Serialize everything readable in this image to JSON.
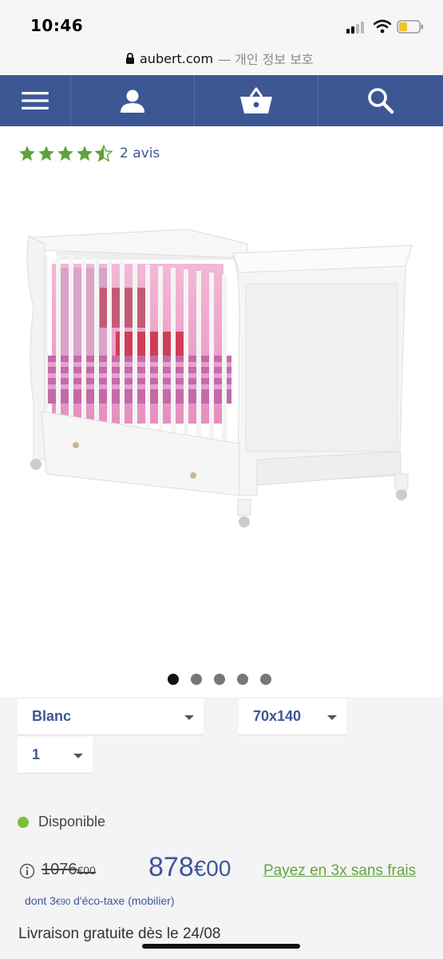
{
  "status_bar": {
    "time": "10:46"
  },
  "url_bar": {
    "domain": "aubert.com",
    "note": "— 개인 정보 보호"
  },
  "nav": {
    "icons": [
      "menu-icon",
      "account-icon",
      "basket-icon",
      "search-icon"
    ],
    "color": "#3d5795"
  },
  "rating": {
    "stars": 4.5,
    "reviews_label": "2 avis",
    "star_color": "#5da33c"
  },
  "product": {
    "image": "white-sleigh-crib-with-drawer"
  },
  "carousel": {
    "count": 5,
    "active_index": 0
  },
  "options": {
    "color_value": "Blanc",
    "size_value": "70x140",
    "quantity_value": "1"
  },
  "availability": {
    "label": "Disponible",
    "status_color": "#7cbf3c"
  },
  "price": {
    "old_main": "1076",
    "old_cents": "€00",
    "new_main": "878",
    "new_cents": "€00",
    "installment_link": "Payez en 3x sans frais",
    "accent_color": "#62a63a"
  },
  "eco_tax": {
    "prefix": "dont 3",
    "cents": "€90",
    "suffix": " d'éco-taxe (mobilier)"
  },
  "delivery": {
    "label": "Livraison gratuite dès le 24/08"
  }
}
